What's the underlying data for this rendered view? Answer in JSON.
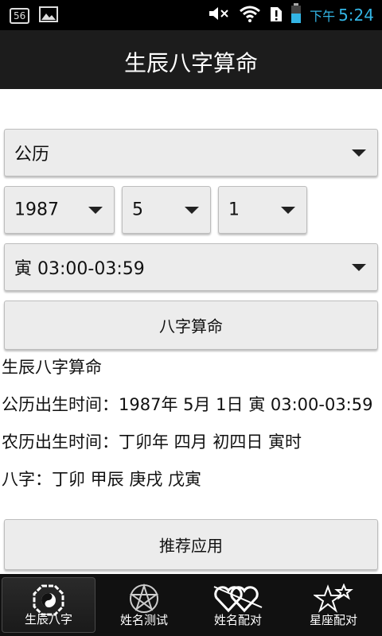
{
  "status_bar": {
    "notification_badge": "56",
    "ampm": "下午",
    "time": "5:24"
  },
  "app": {
    "title": "生辰八字算命"
  },
  "form": {
    "calendar_type": "公历",
    "year": "1987",
    "month": "5",
    "day": "1",
    "hour": "寅 03:00-03:59",
    "submit_label": "八字算命"
  },
  "result": {
    "heading": "生辰八字算命",
    "gregorian": "公历出生时间：1987年 5月 1日 寅 03:00-03:59",
    "lunar": "农历出生时间：丁卯年 四月 初四日 寅时",
    "bazi_partial": "八字：丁卯 甲辰 庚戌 戊寅"
  },
  "recommend_label": "推荐应用",
  "tabs": [
    {
      "label": "生辰八字",
      "icon": "bagua-icon",
      "active": true
    },
    {
      "label": "姓名测试",
      "icon": "pentagram-icon",
      "active": false
    },
    {
      "label": "姓名配对",
      "icon": "hearts-icon",
      "active": false
    },
    {
      "label": "星座配对",
      "icon": "stars-icon",
      "active": false
    }
  ],
  "colors": {
    "accent": "#33b5e5",
    "appbar": "#1c1c1c",
    "tabbar": "#111111"
  }
}
